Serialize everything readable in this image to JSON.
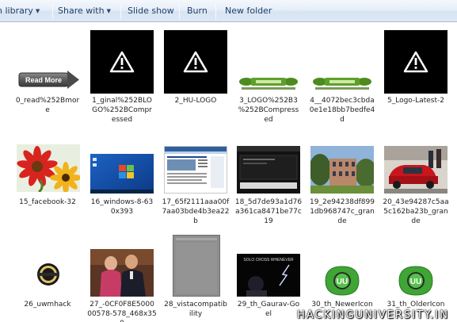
{
  "toolbar": {
    "library_label": "n library",
    "share_label": "Share with",
    "slideshow_label": "Slide show",
    "burn_label": "Burn",
    "newfolder_label": "New folder"
  },
  "files": [
    {
      "name": "0_read%252Bmor\ne",
      "thumb": "read-more-button",
      "thumb_text": "Read More"
    },
    {
      "name": "1_ginal%252BLO\nGO%252BCompr\nessed",
      "thumb": "broken-image"
    },
    {
      "name": "2_HU-LOGO",
      "thumb": "broken-image"
    },
    {
      "name": "3_LOGO%252B3\n%252BCompress\ned",
      "thumb": "green-banner-logo"
    },
    {
      "name": "4__4072bec3cbda\n0e1e18bb7bedfe4\nd",
      "thumb": "green-banner-logo"
    },
    {
      "name": "5_Logo-Latest-2",
      "thumb": "broken-image"
    },
    {
      "name": "15_facebook-32",
      "thumb": "flower-photo"
    },
    {
      "name": "16_windows-8-63\n0x393",
      "thumb": "windows-desktop"
    },
    {
      "name": "17_65f2111aaa00f\n7aa03bde4b3ea22\nb",
      "thumb": "webpage-screenshot"
    },
    {
      "name": "18_5d7de93a1d76\na361ca8471be77c\n19",
      "thumb": "dark-screenshot"
    },
    {
      "name": "19_2e94238df899\n1db968747c_gran\nde",
      "thumb": "building-photo"
    },
    {
      "name": "20_43e94287c5aa\n5c162ba23b_gran\nde",
      "thumb": "car-photo"
    },
    {
      "name": "26_uwmhack",
      "thumb": "round-badge"
    },
    {
      "name": "27_-0CF0F8E5000\n00578-578_468x35\n0",
      "thumb": "people-photo"
    },
    {
      "name": "28_vistacompatib\nility",
      "thumb": "gray-screenshot"
    },
    {
      "name": "29_th_Gaurav-Go\nel",
      "thumb": "lightning-poster",
      "thumb_text": "SOLO CROSS WHENEVER"
    },
    {
      "name": "30_th_NewerIcon",
      "thumb": "uu-icon",
      "thumb_text": "UU"
    },
    {
      "name": "31_th_OlderIcon",
      "thumb": "uu-icon",
      "thumb_text": "UU"
    }
  ],
  "watermark": "HACKINGUNIVERSITY.IN",
  "colors": {
    "toolbar_text": "#1e3f66",
    "uu_green": "#3fa535",
    "banner_green": "#4d8b1f"
  }
}
